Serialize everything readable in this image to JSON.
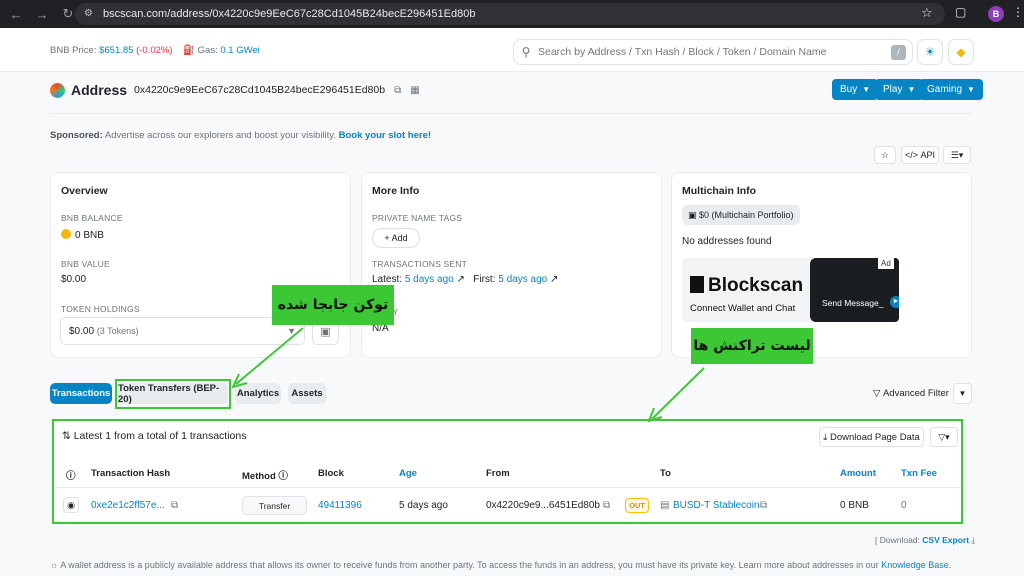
{
  "browser": {
    "url": "bscscan.com/address/0x4220c9e9EeC67c28Cd1045B24becE296451Ed80b",
    "profile_initial": "B"
  },
  "topbar": {
    "price_label": "BNB Price:",
    "price_value": "$651.85",
    "price_change": "(-0.02%)",
    "gas_label": "Gas:",
    "gas_value": "0.1 GWei",
    "search_placeholder": "Search by Address / Txn Hash / Block / Token / Domain Name",
    "search_shortcut": "/"
  },
  "header": {
    "title": "Address",
    "address": "0x4220c9e9EeC67c28Cd1045B24becE296451Ed80b",
    "buttons": [
      "Buy",
      "Play",
      "Gaming"
    ]
  },
  "sponsored": {
    "label": "Sponsored:",
    "text": "Advertise across our explorers and boost your visibility.",
    "link": "Book your slot here!"
  },
  "toolbar": {
    "api_label": "API"
  },
  "overview": {
    "title": "Overview",
    "balance_label": "BNB BALANCE",
    "balance_value": "0 BNB",
    "value_label": "BNB VALUE",
    "value_value": "$0.00",
    "holdings_label": "TOKEN HOLDINGS",
    "holdings_value": "$0.00",
    "holdings_count": "(3 Tokens)"
  },
  "more_info": {
    "title": "More Info",
    "tags_label": "PRIVATE NAME TAGS",
    "add_label": "+ Add",
    "sent_label": "TRANSACTIONS SENT",
    "latest_label": "Latest:",
    "latest_value": "5 days ago",
    "first_label": "First:",
    "first_value": "5 days ago",
    "funded_label": "ED BY",
    "funded_value": "N/A"
  },
  "multichain": {
    "title": "Multichain Info",
    "portfolio": "$0 (Multichain Portfolio)",
    "empty": "No addresses found",
    "ad_brand": "Blockscan",
    "ad_sub": "Connect Wallet and Chat",
    "ad_send": "Send Message_",
    "ad_tag": "Ad"
  },
  "tabs": [
    "Transactions",
    "Token Transfers (BEP-20)",
    "Analytics",
    "Assets"
  ],
  "advanced_filter": "Advanced Filter",
  "transactions": {
    "summary": "Latest 1 from a total of 1 transactions",
    "download": "Download Page Data",
    "columns": [
      "Transaction Hash",
      "Method",
      "Block",
      "Age",
      "From",
      "To",
      "Amount",
      "Txn Fee"
    ],
    "rows": [
      {
        "hash": "0xe2e1c2ff57e...",
        "method": "Transfer",
        "block": "49411396",
        "age": "5 days ago",
        "from": "0x4220c9e9...6451Ed80b",
        "direction": "OUT",
        "to": "BUSD-T Stablecoin",
        "amount": "0 BNB",
        "fee": "0"
      }
    ]
  },
  "csv": {
    "prefix": "[ Download:",
    "link": "CSV Export"
  },
  "footnote": {
    "text": "A wallet address is a publicly available address that allows its owner to receive funds from another party. To access the funds in an address, you must have its private key. Learn more about addresses in our",
    "link": "Knowledge Base."
  },
  "annotations": {
    "token_moved": "توکن جابجا شده",
    "tx_list": "لیست تراکنش ها",
    "color": "#3cc734"
  }
}
